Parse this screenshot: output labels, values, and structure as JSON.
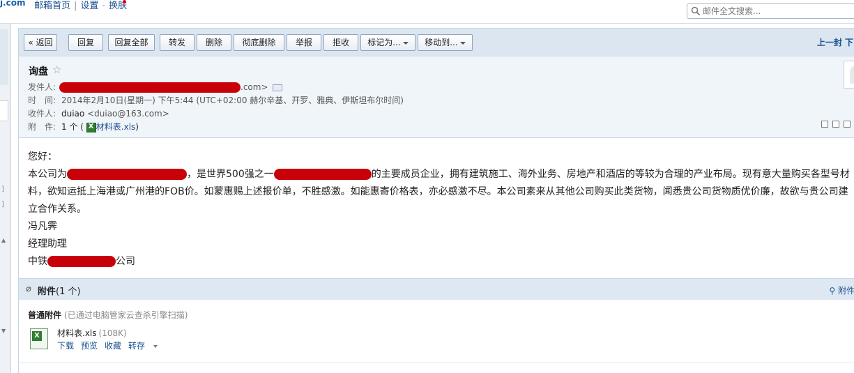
{
  "top": {
    "logo_fragment": "j.com",
    "nav": [
      "邮箱首页",
      "设置",
      "换肤"
    ],
    "search_placeholder": "邮件全文搜索..."
  },
  "toolbar": {
    "back": "« 返回",
    "reply": "回复",
    "reply_all": "回复全部",
    "forward": "转发",
    "delete": "删除",
    "delete_permanent": "彻底删除",
    "report": "举报",
    "reject": "拒收",
    "mark_as": "标记为...",
    "move_to": "移动到...",
    "prev_mail": "上一封 下"
  },
  "header": {
    "subject": "询盘",
    "from_label": "发件人:",
    "from_suffix": ".com>",
    "time_label": "时　间:",
    "time_value": "2014年2月10日(星期一) 下午5:44 (UTC+02:00 赫尔辛基、开罗、雅典、伊斯坦布尔时间)",
    "to_label": "收件人:",
    "to_name": "duiao",
    "to_email": "<duiao@163.com>",
    "attach_label": "附　件:",
    "attach_count": "1 个 (",
    "attach_file": "材料表.xls",
    "attach_close": ")"
  },
  "body": {
    "greeting": "您好：",
    "p1_a": "本公司为",
    "p1_b": "，是世界500强之一",
    "p1_c": "的主要成员企业，拥有建筑施工、海外业务、房地产和酒店的等较为合理的产业布局。现有意大量购买各型号材料，欲知运抵上海港或广州港的FOB价。如蒙惠赐上述报价单，不胜感激。如能惠寄价格表，亦必感激不尽。本公司素来从其他公司购买此类货物，闻悉贵公司货物质优价廉，故欲与贵公司建立合作关系。",
    "sign_name": "冯凡霁",
    "sign_title": "经理助理",
    "sign_company_a": "中铁",
    "sign_company_b": "公司"
  },
  "attachments": {
    "bar_title": "附件",
    "bar_count": "(1 个)",
    "bar_right": "附件",
    "normal_label": "普通附件",
    "scan_note": "(已通过电脑管家云查杀引擎扫描)",
    "file_name": "材料表.xls",
    "file_size": "(108K)",
    "actions": [
      "下载",
      "预览",
      "收藏",
      "转存"
    ]
  },
  "colors": {
    "redaction": "#c8000a",
    "link": "#1a4f8f",
    "toolbar_bg": "#dbe6f1",
    "header_bg": "#f0f5fa"
  }
}
